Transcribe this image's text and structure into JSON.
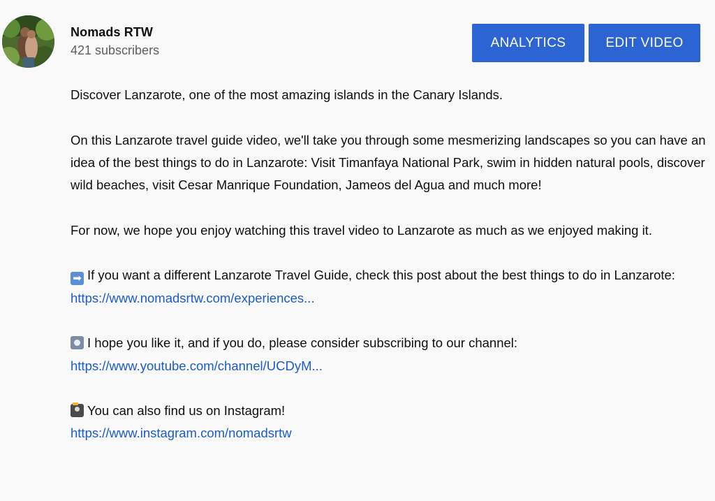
{
  "channel": {
    "name": "Nomads RTW",
    "subscribers": "421 subscribers"
  },
  "buttons": {
    "analytics": "ANALYTICS",
    "edit_video": "EDIT VIDEO"
  },
  "colors": {
    "button_bg": "#2c64d3",
    "link": "#1a5bcd",
    "secondary_text": "#606060",
    "background": "#f9f9f9"
  },
  "description": {
    "intro": "Discover Lanzarote, one of the most amazing islands in the Canary Islands.",
    "body": "On this Lanzarote travel guide video, we'll take you through some mesmerizing landscapes so you can have an idea of the best things to do in Lanzarote: Visit Timanfaya National Park, swim in hidden natural pools, discover wild beaches, visit Cesar Manrique Foundation, Jameos del Agua and much more!",
    "closing": "For now, we hope you enjoy watching this travel video to Lanzarote as much as we enjoyed making it.",
    "guide": {
      "icon": "right-arrow-emoji-icon",
      "text": "If you want a different Lanzarote Travel Guide, check this post about the best things to do in Lanzarote:",
      "link": "https://www.nomadsrtw.com/experiences..."
    },
    "subscribe": {
      "icon": "movie-camera-emoji-icon",
      "text": "I hope you like it, and if you do, please consider subscribing to our channel:",
      "link": "https://www.youtube.com/channel/UCDyM..."
    },
    "instagram": {
      "icon": "camera-with-flash-emoji-icon",
      "text": "You can also find us on Instagram!",
      "link": "https://www.instagram.com/nomadsrtw"
    }
  }
}
